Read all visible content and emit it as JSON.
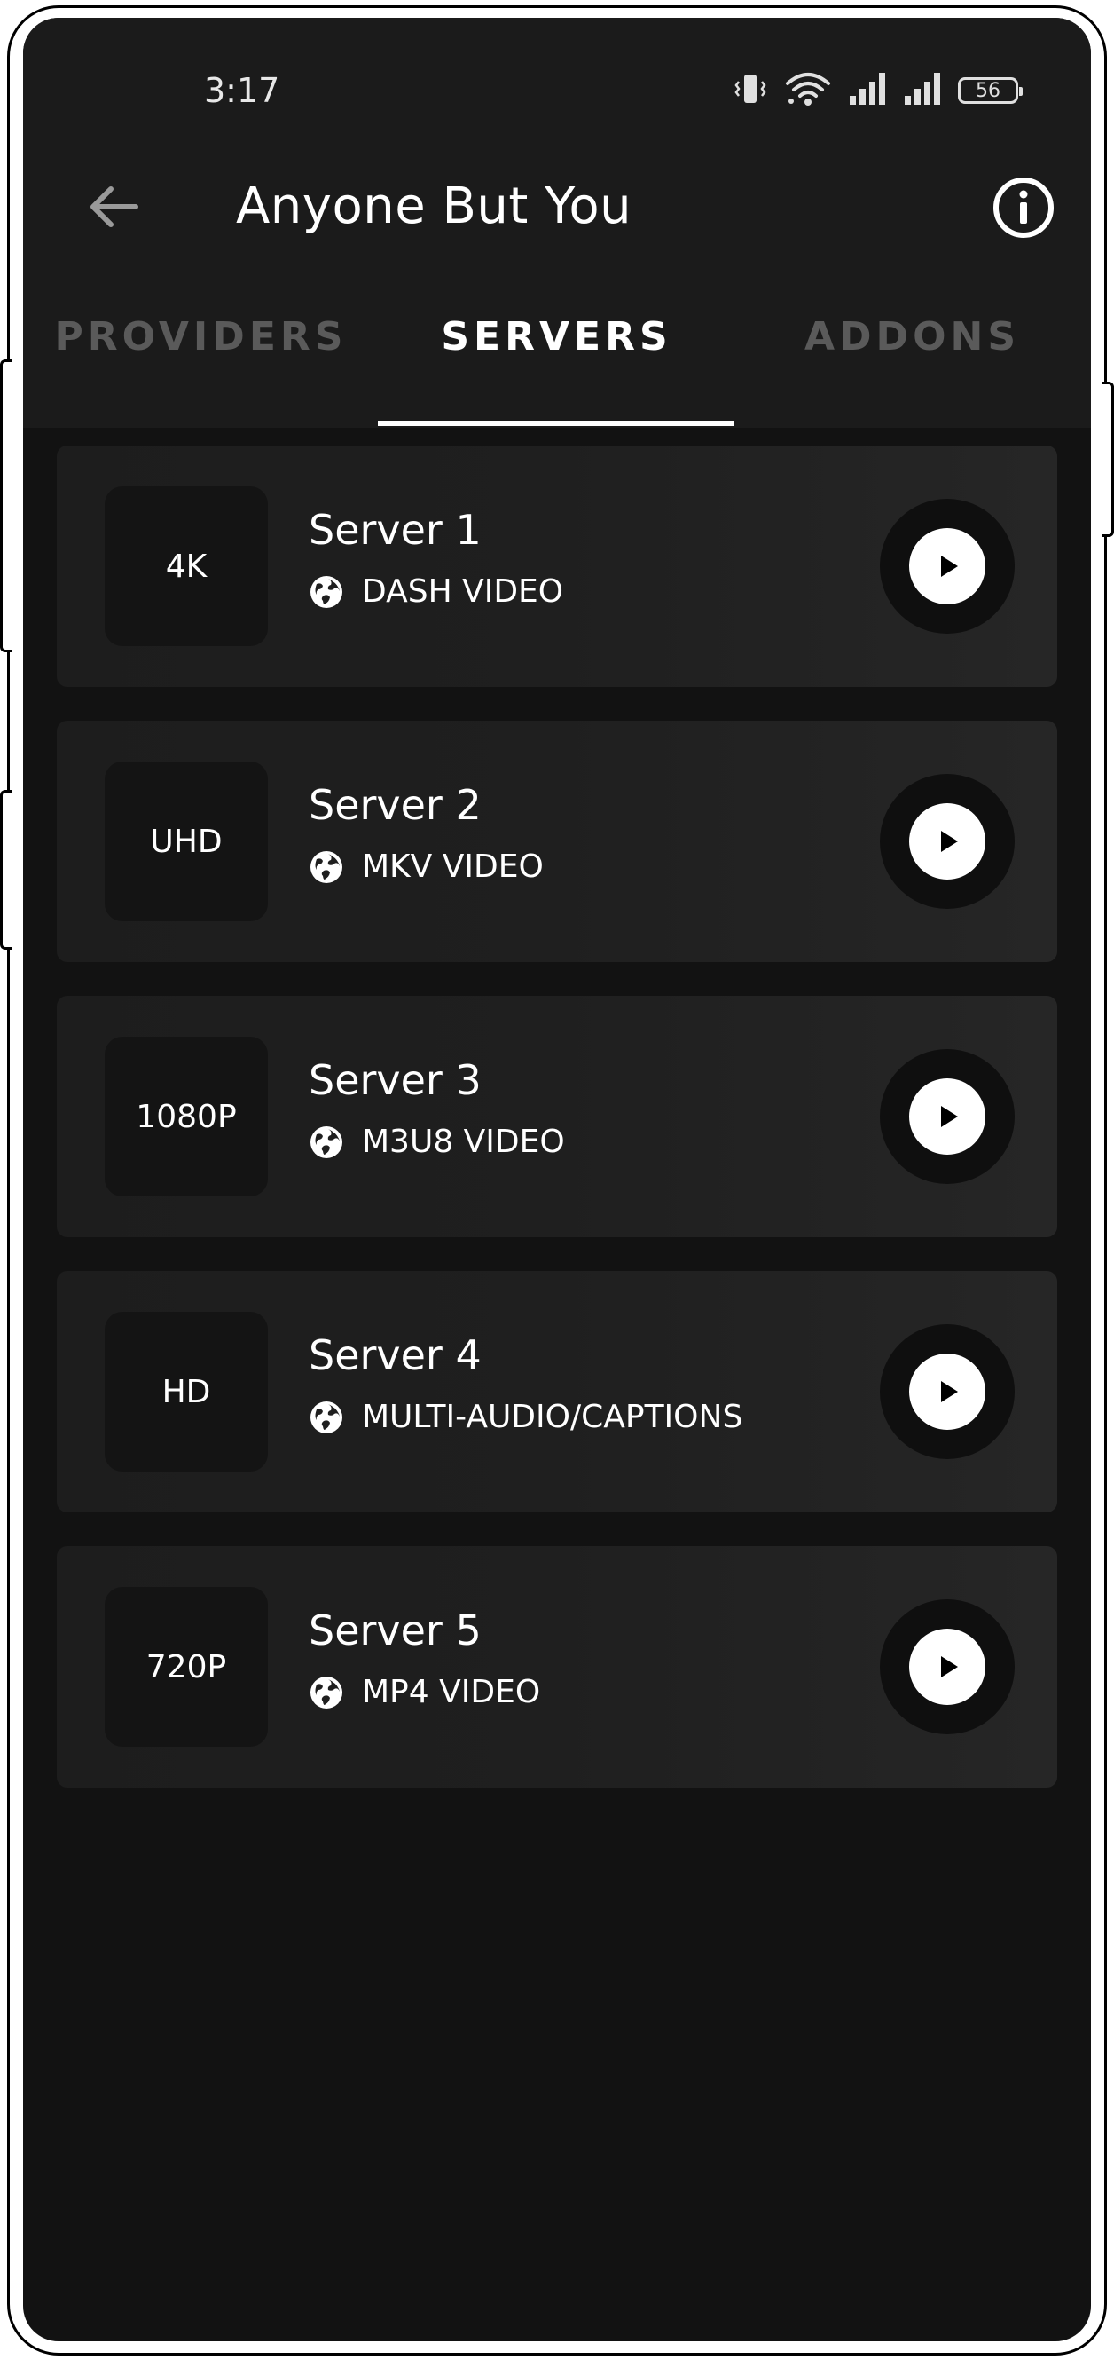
{
  "status_bar": {
    "time": "3:17",
    "battery": "56",
    "icons": [
      "vibrate-icon",
      "wifi-icon",
      "signal-icon",
      "signal-icon"
    ]
  },
  "header": {
    "title": "Anyone But You",
    "back_icon": "arrow-left-icon",
    "info_icon": "info-icon"
  },
  "tabs": [
    {
      "label": "PROVIDERS",
      "active": false
    },
    {
      "label": "SERVERS",
      "active": true
    },
    {
      "label": "ADDONS",
      "active": false
    }
  ],
  "servers": [
    {
      "quality": "4K",
      "name": "Server 1",
      "type": "DASH VIDEO"
    },
    {
      "quality": "UHD",
      "name": "Server 2",
      "type": "MKV VIDEO"
    },
    {
      "quality": "1080P",
      "name": "Server 3",
      "type": "M3U8 VIDEO"
    },
    {
      "quality": "HD",
      "name": "Server 4",
      "type": "MULTI-AUDIO/CAPTIONS"
    },
    {
      "quality": "720P",
      "name": "Server 5",
      "type": "MP4 VIDEO"
    }
  ],
  "colors": {
    "background": "#121212",
    "header": "#1b1b1b",
    "card": "#1f1f1f",
    "accent": "#ffffff",
    "inactive_tab": "#5a5a5a"
  }
}
